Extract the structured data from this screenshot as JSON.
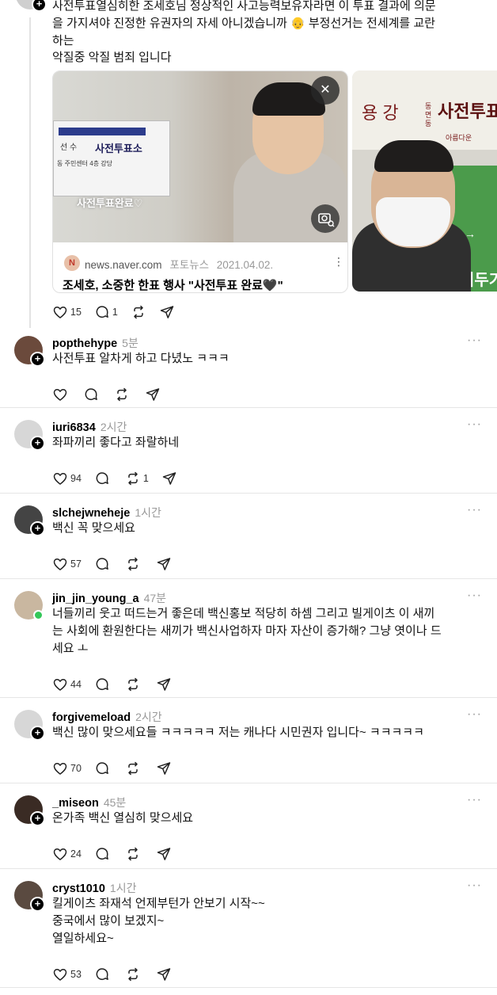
{
  "op": {
    "text_lines": [
      "사전투표열심히한 조세호님 정상적인 사고능력보유자라면 이 투표 결과에 의문",
      "을 가지셔야 진정한 유권자의 자세 아니겠습니까 👴 부정선거는 전세계를 교란",
      "하는",
      "악질중 악질 범죄 입니다"
    ],
    "card": {
      "sign_main": "사전투표소",
      "sign_sub": "선 수",
      "sign_small": "동 주민센터 4층 강당",
      "sign_done": "사전투표완료♡",
      "source": "news.naver.com",
      "category": "포토뉴스",
      "date": "2021.04.02.",
      "headline": "조세호, 소중한 한표 행사 \"사전투표 완료🖤\"",
      "favicon": "N"
    },
    "second_image": {
      "sign_left": "용 강",
      "sign_vert": "동 면 동",
      "sign_main": "사전투표",
      "sign_small": "아름다운",
      "arrow_text": "←→",
      "bottom_text": "리두기"
    },
    "likes": "15",
    "comments": "1"
  },
  "replies": [
    {
      "user": "popthehype",
      "time": "5분",
      "lines": [
        "사전투표 알차게 하고 다녔노 ㅋㅋㅋ"
      ],
      "likes": "",
      "comments": "",
      "reposts": "",
      "avatar": "#6b4a3c"
    },
    {
      "user": "iuri6834",
      "time": "2시간",
      "lines": [
        "좌파끼리 좋다고 좌랄하네"
      ],
      "likes": "94",
      "comments": "",
      "reposts": "1",
      "avatar": "#d7d7d7"
    },
    {
      "user": "slchejwneheje",
      "time": "1시간",
      "lines": [
        "백신 꼭 맞으세요"
      ],
      "likes": "57",
      "comments": "",
      "reposts": "",
      "avatar": "#444444"
    },
    {
      "user": "jin_jin_young_a",
      "time": "47분",
      "lines": [
        "너들끼리 웃고 떠드는거 좋은데 백신홍보 적당히 하셈 그리고 빌게이츠 이 새끼",
        "는 사회에 환원한다는 새끼가 백신사업하자 마자 자산이 증가해? 그냥 엿이나 드",
        "세요 ㅗ"
      ],
      "likes": "44",
      "comments": "",
      "reposts": "",
      "avatar": "#c9b7a0"
    },
    {
      "user": "forgivemeload",
      "time": "2시간",
      "lines": [
        "백신 많이 맞으세요들 ㅋㅋㅋㅋㅋ 저는 캐나다 시민권자 입니다~ ㅋㅋㅋㅋㅋ"
      ],
      "likes": "70",
      "comments": "",
      "reposts": "",
      "avatar": "#d7d7d7"
    },
    {
      "user": "_miseon",
      "time": "45분",
      "lines": [
        "온가족 백신 열심히 맞으세요"
      ],
      "likes": "24",
      "comments": "",
      "reposts": "",
      "avatar": "#3a2b24"
    },
    {
      "user": "cryst1010",
      "time": "1시간",
      "lines": [
        "킬게이츠 좌재석 언제부턴가 안보기 시작~~",
        "중국에서 많이 보겠지~",
        "열일하세요~"
      ],
      "likes": "53",
      "comments": "",
      "reposts": "",
      "avatar": "#5a4a40"
    }
  ],
  "icons": {
    "like": "heart-icon",
    "comment": "comment-icon",
    "repost": "repost-icon",
    "share": "share-icon",
    "more": "more-icon",
    "close": "close-icon",
    "camera": "camera-search-icon"
  },
  "more_glyph": "···",
  "plus_glyph": "+",
  "close_glyph": "✕"
}
